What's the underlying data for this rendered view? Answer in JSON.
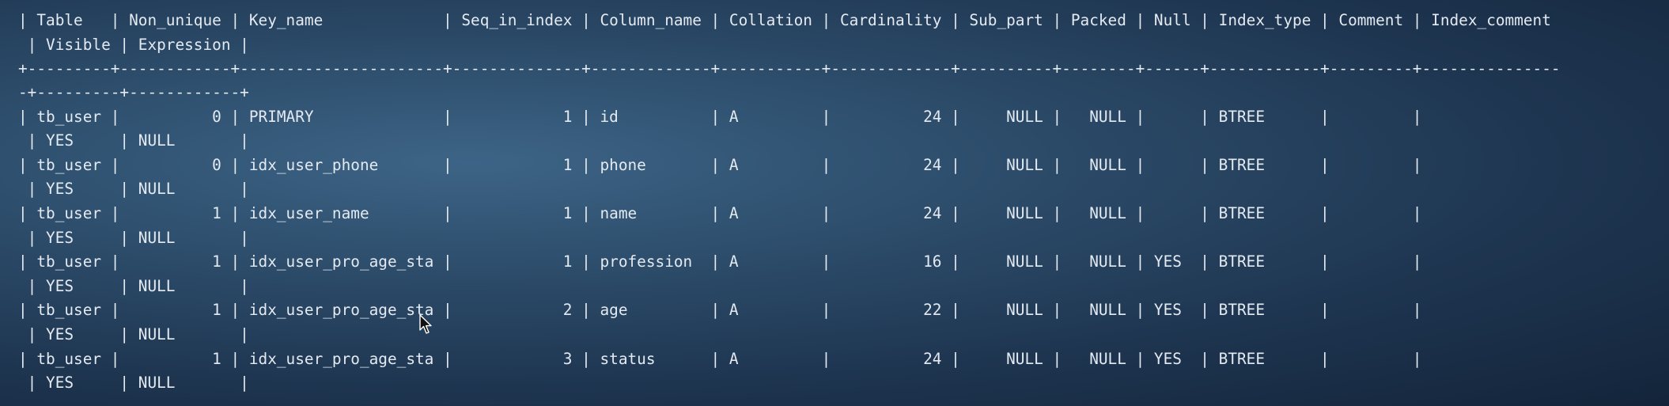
{
  "terminal": {
    "lines": [
      "| Table   | Non_unique | Key_name             | Seq_in_index | Column_name | Collation | Cardinality | Sub_part | Packed | Null | Index_type | Comment | Index_comment",
      " | Visible | Expression |",
      "+---------+------------+----------------------+--------------+-------------+-----------+-------------+----------+--------+------+------------+---------+---------------",
      "-+---------+------------+",
      "| tb_user |          0 | PRIMARY              |            1 | id          | A         |          24 |     NULL |   NULL |      | BTREE      |         |",
      " | YES     | NULL       |",
      "| tb_user |          0 | idx_user_phone       |            1 | phone       | A         |          24 |     NULL |   NULL |      | BTREE      |         |",
      " | YES     | NULL       |",
      "| tb_user |          1 | idx_user_name        |            1 | name        | A         |          24 |     NULL |   NULL |      | BTREE      |         |",
      " | YES     | NULL       |",
      "| tb_user |          1 | idx_user_pro_age_sta |            1 | profession  | A         |          16 |     NULL |   NULL | YES  | BTREE      |         |",
      " | YES     | NULL       |",
      "| tb_user |          1 | idx_user_pro_age_sta |            2 | age         | A         |          22 |     NULL |   NULL | YES  | BTREE      |         |",
      " | YES     | NULL       |",
      "| tb_user |          1 | idx_user_pro_age_sta |            3 | status      | A         |          24 |     NULL |   NULL | YES  | BTREE      |         |",
      " | YES     | NULL       |"
    ]
  },
  "cursor": {
    "icon": "mouse-pointer-icon"
  }
}
